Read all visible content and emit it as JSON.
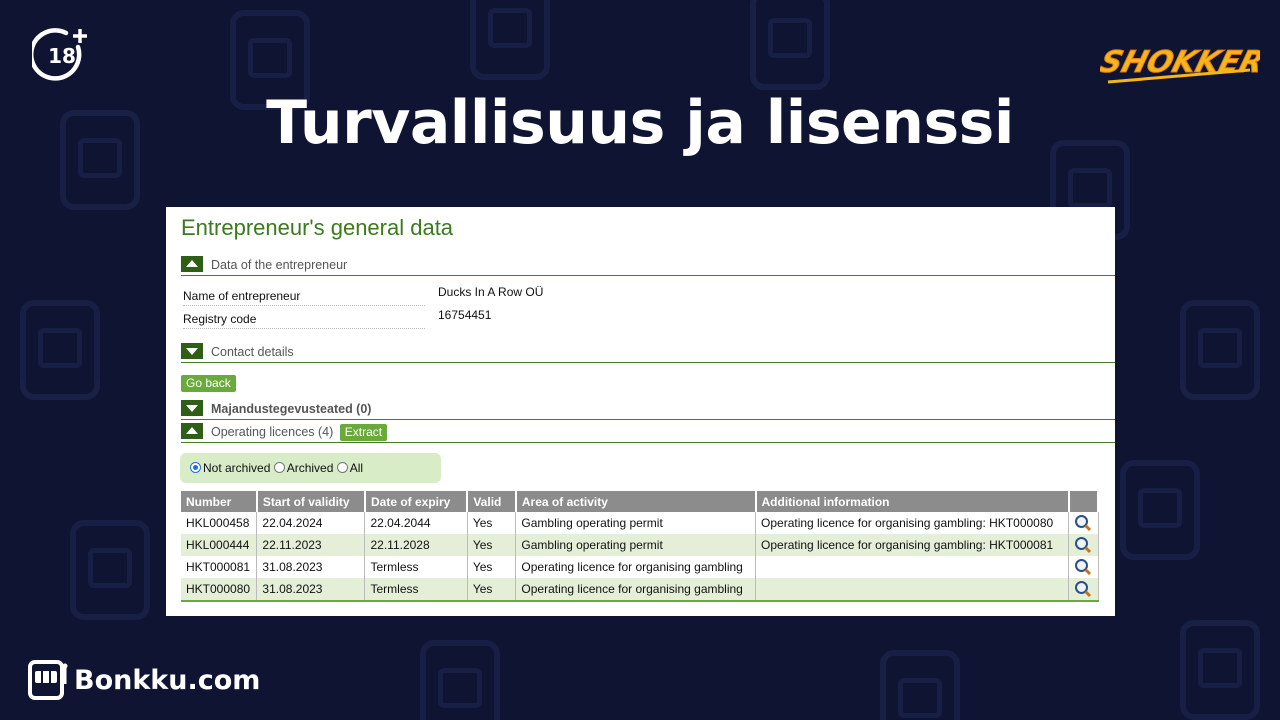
{
  "slide": {
    "title": "Turvallisuus ja lisenssi",
    "age_badge": "18",
    "brand_logo": "SHOKKER",
    "footer_brand": "Bonkku.com"
  },
  "panel": {
    "heading": "Entrepreneur's general data",
    "sections": {
      "data": "Data of the entrepreneur",
      "contact": "Contact details",
      "economic": "Majandustegevusteated (0)",
      "licences": "Operating licences (4)"
    },
    "fields": {
      "name_label": "Name of entrepreneur",
      "name_value": "Ducks In A Row OÜ",
      "reg_label": "Registry code",
      "reg_value": "16754451"
    },
    "go_back": "Go back",
    "extract": "Extract",
    "filter": {
      "not_archived": "Not archived",
      "archived": "Archived",
      "all": "All"
    },
    "table": {
      "headers": [
        "Number",
        "Start of validity",
        "Date of expiry",
        "Valid",
        "Area of activity",
        "Additional information"
      ],
      "rows": [
        [
          "HKL000458",
          "22.04.2024",
          "22.04.2044",
          "Yes",
          "Gambling operating permit",
          "Operating licence for organising gambling: HKT000080"
        ],
        [
          "HKL000444",
          "22.11.2023",
          "22.11.2028",
          "Yes",
          "Gambling operating permit",
          "Operating licence for organising gambling: HKT000081"
        ],
        [
          "HKT000081",
          "31.08.2023",
          "Termless",
          "Yes",
          "Operating licence for organising gambling",
          ""
        ],
        [
          "HKT000080",
          "31.08.2023",
          "Termless",
          "Yes",
          "Operating licence for organising gambling",
          ""
        ]
      ]
    }
  },
  "colors": {
    "background": "#0f1433",
    "heading_green": "#3c7a1e",
    "toggle_green": "#2f5e16",
    "button_green": "#6aaa3a",
    "row_alt": "#e5efd8",
    "brand_yellow": "#f7b51c"
  },
  "icons": {
    "age": "18-plus-icon",
    "view": "magnifier-icon",
    "slot": "slot-machine-icon"
  }
}
